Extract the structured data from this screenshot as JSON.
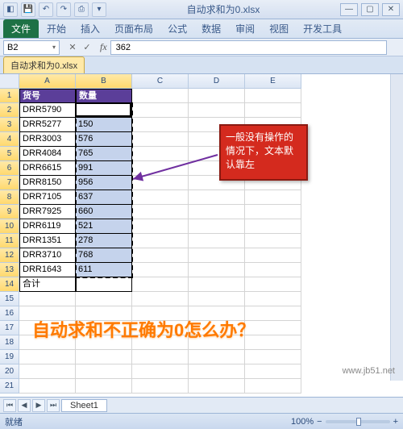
{
  "window": {
    "title": "自动求和为0.xlsx"
  },
  "ribbon": {
    "file": "文件",
    "tabs": [
      "开始",
      "插入",
      "页面布局",
      "公式",
      "数据",
      "审阅",
      "视图",
      "开发工具"
    ]
  },
  "namebox": {
    "cell": "B2"
  },
  "formula_bar": {
    "value": "362"
  },
  "doc_tab": "自动求和为0.xlsx",
  "columns": [
    "A",
    "B",
    "C",
    "D",
    "E"
  ],
  "rows": [
    1,
    2,
    3,
    4,
    5,
    6,
    7,
    8,
    9,
    10,
    11,
    12,
    13,
    14,
    15,
    16,
    17,
    18,
    19,
    20,
    21
  ],
  "headers": {
    "a": "货号",
    "b": "数量"
  },
  "data": [
    {
      "a": "DRR5790",
      "b": "362"
    },
    {
      "a": "DRR5277",
      "b": "150"
    },
    {
      "a": "DRR3003",
      "b": "576"
    },
    {
      "a": "DRR4084",
      "b": "765"
    },
    {
      "a": "DRR6615",
      "b": "991"
    },
    {
      "a": "DRR8150",
      "b": "956"
    },
    {
      "a": "DRR7105",
      "b": "637"
    },
    {
      "a": "DRR7925",
      "b": "660"
    },
    {
      "a": "DRR6119",
      "b": "521"
    },
    {
      "a": "DRR1351",
      "b": "278"
    },
    {
      "a": "DRR3710",
      "b": "768"
    },
    {
      "a": "DRR1643",
      "b": "611"
    }
  ],
  "total_row": {
    "a": "合计",
    "b": ""
  },
  "callout": "一般没有操作的情况下，文本默认靠左",
  "big_text": "自动求和不正确为0怎么办？",
  "sheet_tab": "Sheet1",
  "status": {
    "mode": "就绪",
    "zoom": "100%"
  },
  "watermark": "www.jb51.net",
  "chart_data": {
    "type": "table",
    "title": "自动求和为0.xlsx",
    "columns": [
      "货号",
      "数量"
    ],
    "rows": [
      [
        "DRR5790",
        362
      ],
      [
        "DRR5277",
        150
      ],
      [
        "DRR3003",
        576
      ],
      [
        "DRR4084",
        765
      ],
      [
        "DRR6615",
        991
      ],
      [
        "DRR8150",
        956
      ],
      [
        "DRR7105",
        637
      ],
      [
        "DRR7925",
        660
      ],
      [
        "DRR6119",
        521
      ],
      [
        "DRR1351",
        278
      ],
      [
        "DRR3710",
        768
      ],
      [
        "DRR1643",
        611
      ]
    ],
    "total_label": "合计"
  }
}
